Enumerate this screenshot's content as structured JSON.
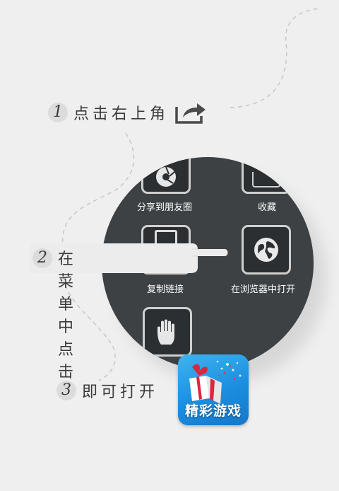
{
  "steps": [
    {
      "number": "1",
      "text": "点击右上角"
    },
    {
      "number": "2",
      "text": "在菜单中点击"
    },
    {
      "number": "3",
      "text": "即可打开"
    }
  ],
  "menu": {
    "items": [
      {
        "label": "分享到朋友圈",
        "icon": "camera-shutter-icon"
      },
      {
        "label": "收藏",
        "icon": "favorite-icon"
      },
      {
        "label": "复制链接",
        "icon": "copy-link-icon"
      },
      {
        "label": "在浏览器中打开",
        "icon": "globe-icon"
      },
      {
        "label": "",
        "icon": "hand-icon"
      }
    ]
  },
  "app": {
    "label": "精彩游戏",
    "icon": "gift-box-icon"
  },
  "colors": {
    "background": "#efefef",
    "menu_bg": "#3d4143",
    "app_blue": "#1b8ee0"
  }
}
